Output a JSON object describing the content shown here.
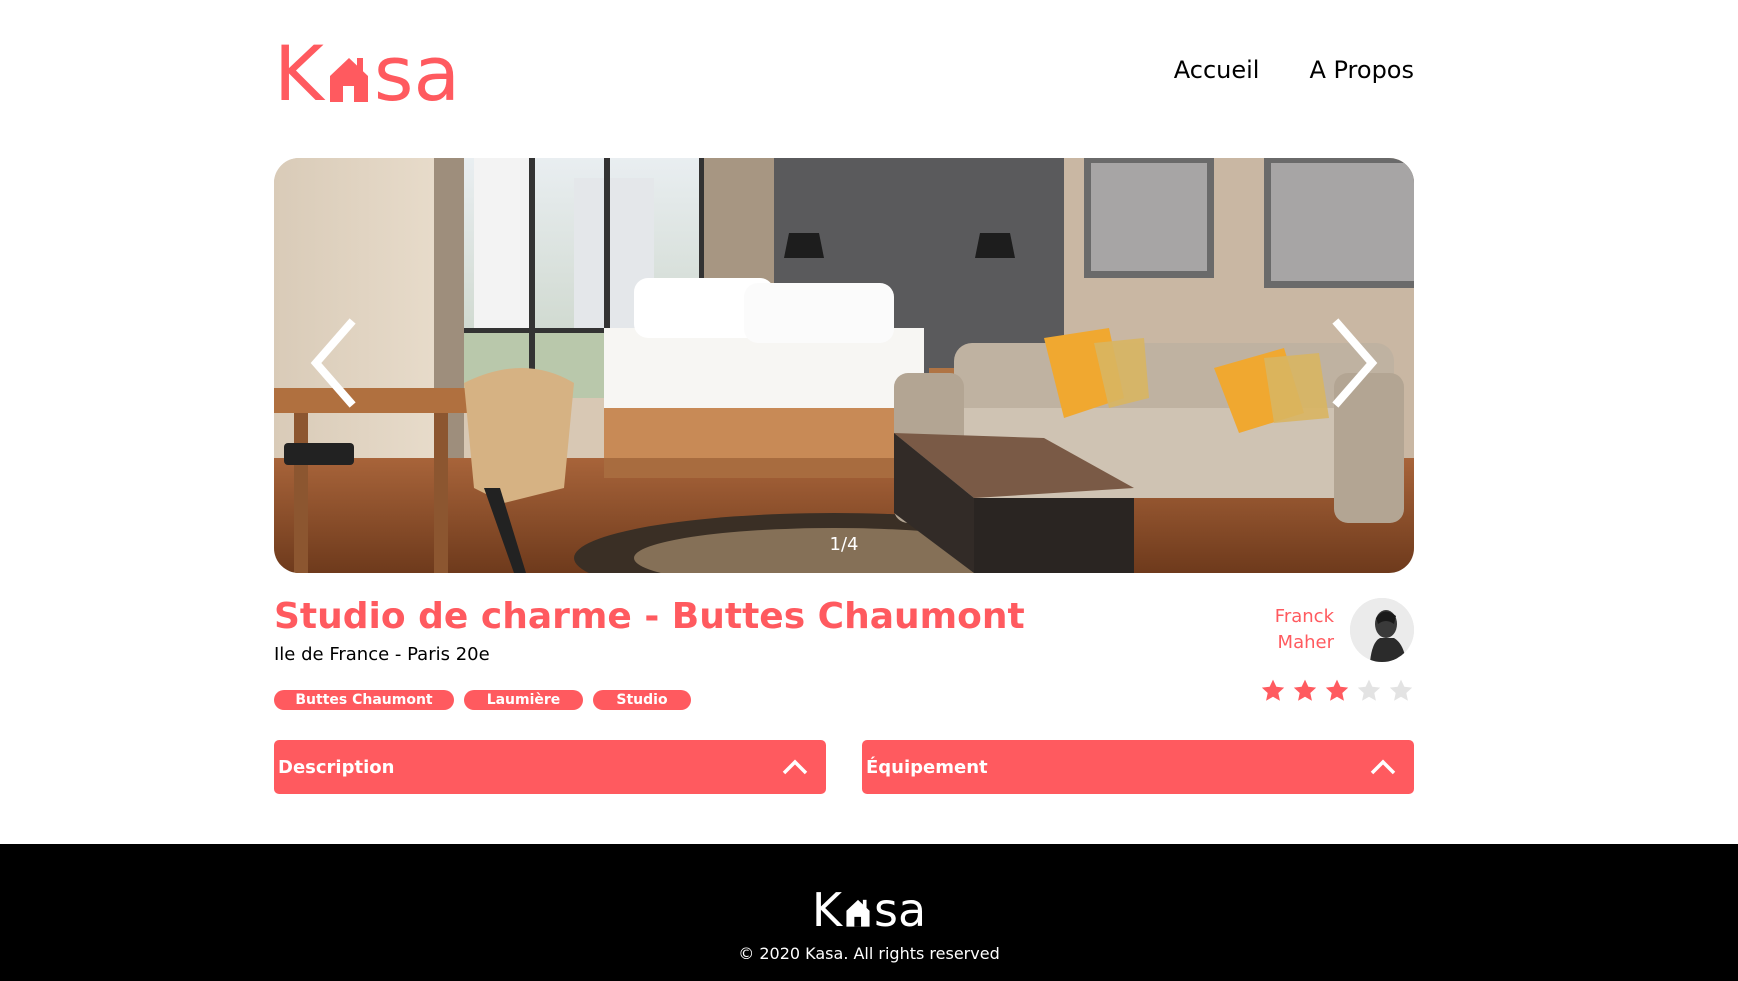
{
  "brand": {
    "logo_k": "K",
    "logo_sa": "sa",
    "accent": "#FF5A5F"
  },
  "nav": {
    "home_label": "Accueil",
    "about_label": "A Propos"
  },
  "gallery": {
    "counter": "1/4",
    "prev_icon": "chevron-left-icon",
    "next_icon": "chevron-right-icon"
  },
  "listing": {
    "title": "Studio de charme - Buttes Chaumont",
    "location": "Ile de France - Paris 20e",
    "tags": [
      "Buttes Chaumont",
      "Laumière",
      "Studio"
    ]
  },
  "host": {
    "first_name": "Franck",
    "last_name": "Maher"
  },
  "rating": {
    "value": 3,
    "max": 5,
    "filled_color": "#FF5A5F",
    "empty_color": "#E3E3E3"
  },
  "collapses": {
    "description_label": "Description",
    "equipment_label": "Équipement"
  },
  "footer": {
    "logo_k": "K",
    "logo_sa": "sa",
    "copyright": "© 2020 Kasa. All rights reserved"
  }
}
